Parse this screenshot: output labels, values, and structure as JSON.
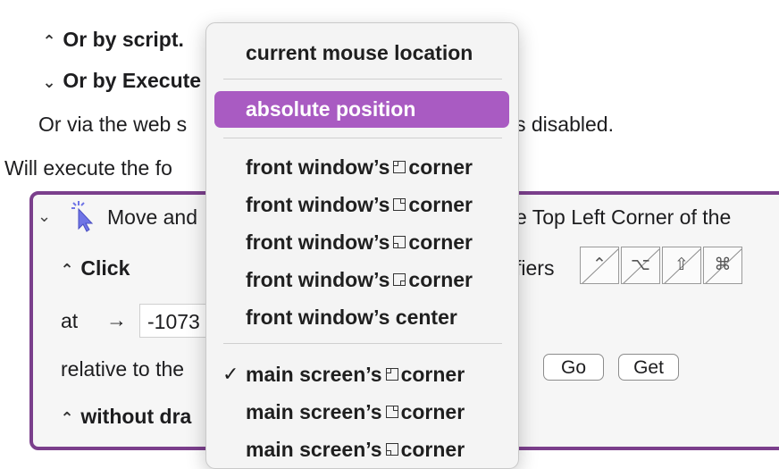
{
  "background_rows": {
    "or_by_script": "Or by script.",
    "or_by_execute": "Or by Execute",
    "web_server_left": "Or via the web s",
    "web_server_right": "s disabled.",
    "will_execute": "Will execute the fo"
  },
  "action": {
    "title_left": "Move and",
    "title_right": "e Top Left Corner of the",
    "click_label": "Click",
    "modifiers_label": "fiers",
    "modifier_keys": [
      "⌃",
      "⌥",
      "⇧",
      "⌘"
    ],
    "at_label": "at",
    "arrow": "→",
    "x_value": "-1073",
    "relative_label": "relative to the",
    "go_button": "Go",
    "get_button": "Get",
    "drag_label": "without dra"
  },
  "menu": {
    "items": [
      {
        "label": "current mouse location"
      },
      {
        "label": "absolute position"
      },
      {
        "prefix": "front window’s",
        "corner": "tl",
        "suffix": "corner"
      },
      {
        "prefix": "front window’s",
        "corner": "tr",
        "suffix": "corner"
      },
      {
        "prefix": "front window’s",
        "corner": "bl",
        "suffix": "corner"
      },
      {
        "prefix": "front window’s",
        "corner": "br",
        "suffix": "corner"
      },
      {
        "label": "front window’s center"
      },
      {
        "prefix": "main screen’s",
        "corner": "tl",
        "suffix": "corner",
        "checkmark": "✓"
      },
      {
        "prefix": "main screen’s",
        "corner": "tr",
        "suffix": "corner"
      },
      {
        "prefix": "main screen’s",
        "corner": "bl",
        "suffix": "corner"
      }
    ],
    "selected_index": 1
  },
  "colors": {
    "action_border": "#7b3f8c",
    "menu_highlight": "#a95bc2"
  }
}
